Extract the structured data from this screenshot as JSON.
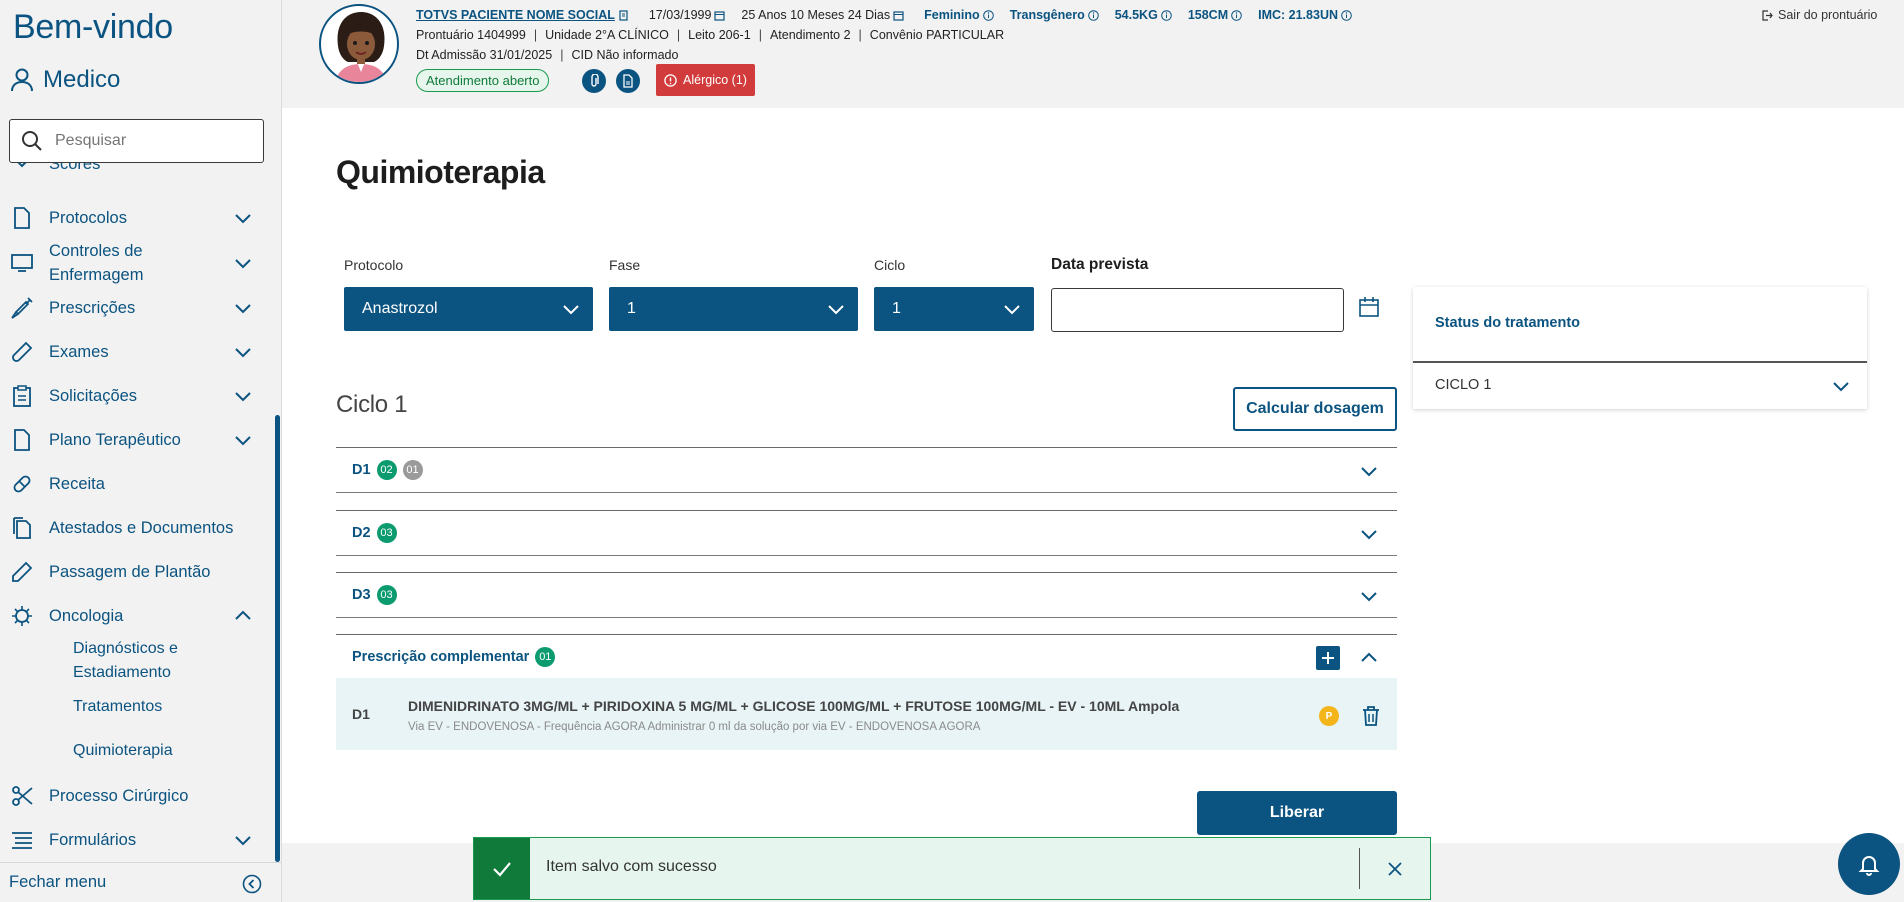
{
  "sidebar": {
    "welcome": "Bem-vindo",
    "role": "Medico",
    "search_placeholder": "Pesquisar",
    "items": [
      {
        "label": "Scores"
      },
      {
        "label": "Protocolos"
      },
      {
        "label": "Controles de\nEnfermagem"
      },
      {
        "label": "Prescrições"
      },
      {
        "label": "Exames"
      },
      {
        "label": "Solicitações"
      },
      {
        "label": "Plano Terapêutico"
      },
      {
        "label": "Receita"
      },
      {
        "label": "Atestados e Documentos"
      },
      {
        "label": "Passagem de Plantão"
      },
      {
        "label": "Oncologia"
      },
      {
        "label": "Processo Cirúrgico"
      },
      {
        "label": "Formulários"
      }
    ],
    "oncologia_sub": [
      "Diagnósticos e",
      "Estadiamento",
      "Tratamentos",
      "Quimioterapia"
    ],
    "footer_label": "Fechar menu"
  },
  "patient": {
    "name": "TOTVS PACIENTE NOME SOCIAL",
    "birth": "17/03/1999",
    "age": "25 Anos 10 Meses 24 Dias",
    "sex": "Feminino",
    "gender": "Transgênero",
    "weight": "54.5KG",
    "height": "158CM",
    "imc": "IMC: 21.83UN",
    "prontuario": "Prontuário 1404999",
    "unidade": "Unidade 2°A CLÍNICO",
    "leito": "Leito 206-1",
    "atendimento": "Atendimento 2",
    "convenio": "Convênio PARTICULAR",
    "admissao": "Dt Admissão 31/01/2025",
    "cid": "CID Não informado",
    "status_badge": "Atendimento aberto",
    "allergy": "Alérgico (1)",
    "logout": "Sair do prontuário"
  },
  "page": {
    "title": "Quimioterapia",
    "protocolo_label": "Protocolo",
    "protocolo_value": "Anastrozol",
    "fase_label": "Fase",
    "fase_value": "1",
    "ciclo_label": "Ciclo",
    "ciclo_value": "1",
    "data_label": "Data prevista",
    "data_value": "",
    "cycle_heading": "Ciclo 1",
    "calc_button": "Calcular dosagem",
    "days": [
      {
        "label": "D1",
        "badges": [
          "02",
          "01"
        ]
      },
      {
        "label": "D2",
        "badges": [
          "03"
        ]
      },
      {
        "label": "D3",
        "badges": [
          "03"
        ]
      }
    ],
    "complementar": {
      "label": "Prescrição complementar",
      "badge": "01"
    },
    "item": {
      "day": "D1",
      "name": "DIMENIDRINATO 3MG/ML + PIRIDOXINA 5 MG/ML + GLICOSE 100MG/ML + FRUTOSE 100MG/ML - EV - 10ML Ampola",
      "details": "Via EV - ENDOVENOSA - Frequência AGORA Administrar 0 ml da solução por via EV - ENDOVENOSA AGORA",
      "badge": "P"
    },
    "liberar": "Liberar"
  },
  "status_panel": {
    "title": "Status do tratamento",
    "cycle": "CICLO 1"
  },
  "toast": {
    "message": "Item salvo com sucesso"
  },
  "colors": {
    "primary": "#0b5380",
    "success": "#107a3a",
    "danger": "#d23b3b",
    "warning": "#f4b51a",
    "badge": "#0c9b6f"
  }
}
